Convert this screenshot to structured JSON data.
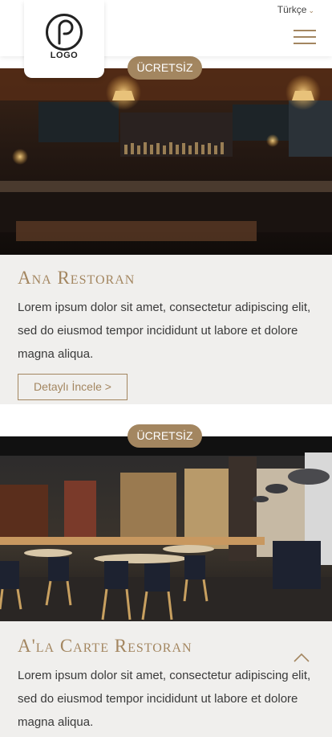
{
  "header": {
    "logo_text": "LOGO",
    "language": "Türkçe"
  },
  "sections": [
    {
      "badge": "ÜCRETSİZ",
      "title": "Ana Restoran",
      "description": "Lorem ipsum dolor sit amet, consectetur adipiscing elit, sed do eiusmod tempor incididunt ut labore et dolore magna aliqua.",
      "button": "Detaylı İncele >"
    },
    {
      "badge": "ÜCRETSİZ",
      "title": "A'la Carte Restoran",
      "description": "Lorem ipsum dolor sit amet, consectetur adipiscing elit, sed do eiusmod tempor incididunt ut labore et dolore magna aliqua."
    }
  ],
  "colors": {
    "accent": "#a38660",
    "section_bg": "#f0efed"
  },
  "icons": [
    "logo-icon",
    "chevron-down-icon",
    "hamburger-menu-icon",
    "chevron-up-icon"
  ]
}
